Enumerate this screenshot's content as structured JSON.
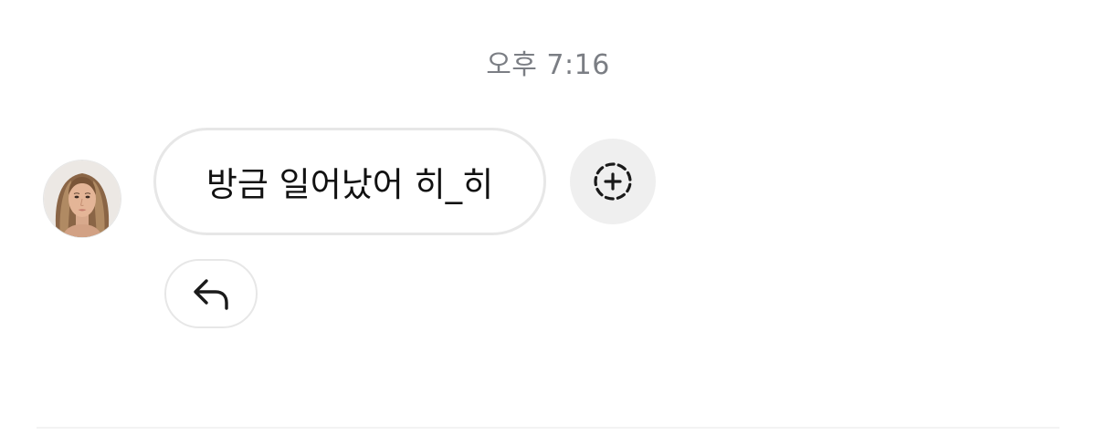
{
  "conversation": {
    "timestamp": "오후 7:16",
    "message": {
      "text": "방금 일어났어 히_히",
      "sender_avatar_icon": "profile-photo"
    },
    "actions": {
      "react_icon": "add-reaction-icon",
      "reply_icon": "reply-arrow-icon"
    }
  },
  "colors": {
    "timestamp": "#7b7e84",
    "bubble_border": "#e7e7e7",
    "react_bg": "#efefef",
    "text": "#111111"
  }
}
